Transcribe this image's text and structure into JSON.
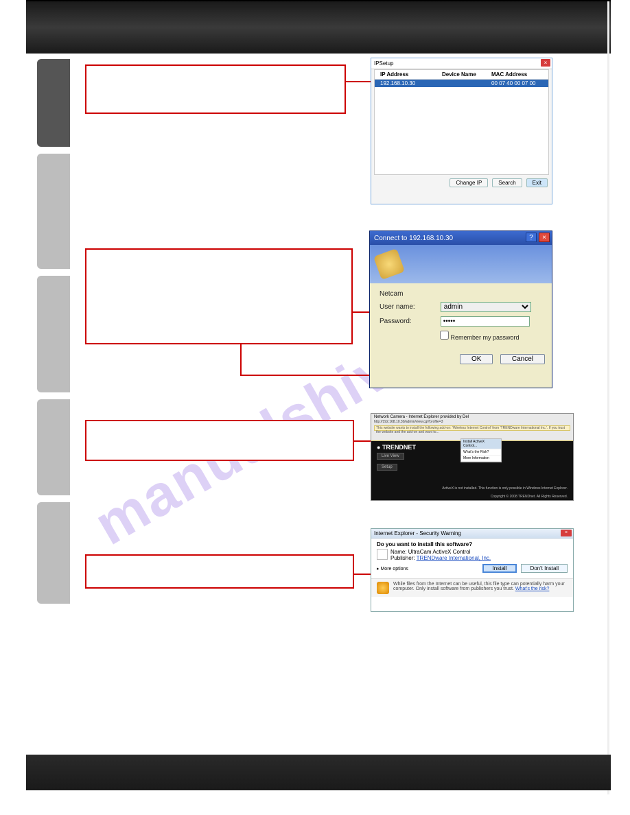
{
  "watermark": "manualshive.com",
  "shot1": {
    "title": "IPSetup",
    "columns": [
      "IP Address",
      "Device Name",
      "MAC Address"
    ],
    "row": {
      "ip": "192.168.10.30",
      "name": "",
      "mac": "00 07 40 00 07 00"
    },
    "buttons": {
      "change": "Change IP",
      "search": "Search",
      "exit": "Exit"
    }
  },
  "shot2": {
    "title": "Connect to 192.168.10.30",
    "realm": "Netcam",
    "labels": {
      "user": "User name:",
      "pass": "Password:",
      "remember": "Remember my password"
    },
    "values": {
      "user": "admin",
      "pass": "•••••"
    },
    "buttons": {
      "ok": "OK",
      "cancel": "Cancel"
    }
  },
  "shot3": {
    "tab_title": "Network Camera - Internet Explorer provided by Del",
    "url": "http://192.168.10.30/admin/view.cgi?profile=3",
    "infobar": "This website wants to install the following add-on: 'Wireless Internet Control' from 'TRENDware International Inc.'. If you trust the website and the add-on and want to...",
    "menu": [
      "Install ActiveX Control...",
      "What's the Risk?",
      "More Information"
    ],
    "logo": "TRENDNET",
    "left_btns": [
      "Live View",
      "Setup"
    ],
    "footer_msg": "ActiveX is not installed. This function is only possible in Windows Internet Explorer.",
    "copyright": "Copyright © 2008 TRENDnet. All Rights Reserved."
  },
  "shot4": {
    "title": "Internet Explorer - Security Warning",
    "question": "Do you want to install this software?",
    "name_label": "Name:",
    "name": "UltraCam ActiveX Control",
    "pub_label": "Publisher:",
    "publisher": "TRENDware International, Inc.",
    "more": "More options",
    "install": "Install",
    "dont": "Don't Install",
    "warn": "While files from the Internet can be useful, this file type can potentially harm your computer. Only install software from publishers you trust.",
    "risk": "What's the risk?"
  }
}
